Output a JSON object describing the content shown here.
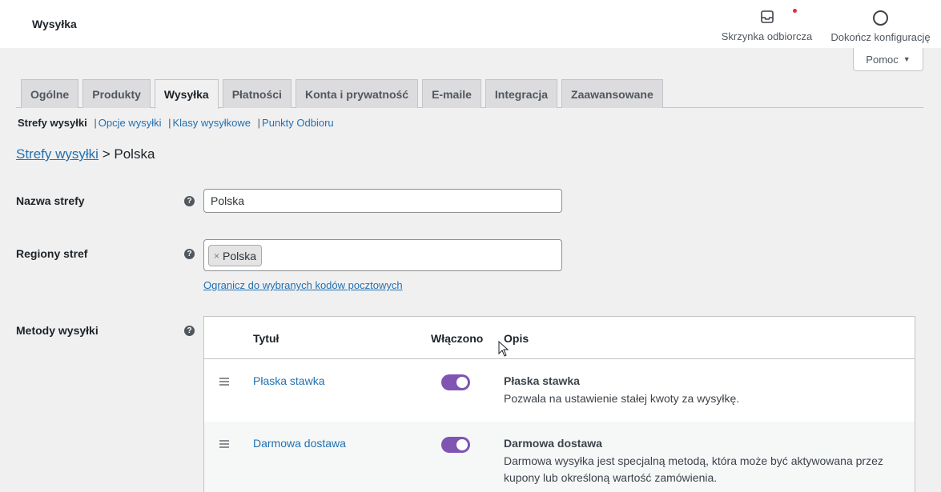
{
  "topbar": {
    "title": "Wysyłka",
    "inbox_label": "Skrzynka odbiorcza",
    "inbox_icon": "inbox-icon",
    "setup_label": "Dokończ konfigurację",
    "setup_icon": "progress-ring-icon"
  },
  "help": {
    "label": "Pomoc"
  },
  "tabs": [
    {
      "label": "Ogólne",
      "active": false
    },
    {
      "label": "Produkty",
      "active": false
    },
    {
      "label": "Wysyłka",
      "active": true
    },
    {
      "label": "Płatności",
      "active": false
    },
    {
      "label": "Konta i prywatność",
      "active": false
    },
    {
      "label": "E-maile",
      "active": false
    },
    {
      "label": "Integracja",
      "active": false
    },
    {
      "label": "Zaawansowane",
      "active": false
    }
  ],
  "subnav": {
    "current": "Strefy wysyłki",
    "links": [
      "Opcje wysyłki",
      "Klasy wysyłkowe",
      "Punkty Odbioru"
    ],
    "separator": "|"
  },
  "breadcrumb": {
    "parent": "Strefy wysyłki",
    "separator": ">",
    "current": "Polska"
  },
  "form": {
    "zone_name_label": "Nazwa strefy",
    "zone_name_value": "Polska",
    "regions_label": "Regiony stref",
    "regions": [
      {
        "label": "Polska",
        "remove": "×"
      }
    ],
    "zip_link": "Ogranicz do wybranych kodów pocztowych",
    "methods_label": "Metody wysyłki",
    "help_glyph": "?"
  },
  "methods": {
    "headers": {
      "title": "Tytuł",
      "enabled": "Włączono",
      "description": "Opis"
    },
    "rows": [
      {
        "title": "Płaska stawka",
        "enabled": true,
        "desc_title": "Płaska stawka",
        "desc": "Pozwala na ustawienie stałej kwoty za wysyłkę."
      },
      {
        "title": "Darmowa dostawa",
        "enabled": true,
        "desc_title": "Darmowa dostawa",
        "desc": "Darmowa wysyłka jest specjalną metodą, która może być aktywowana przez kupony lub określoną wartość zamówienia."
      }
    ]
  },
  "colors": {
    "link": "#2271b1",
    "toggle_on": "#7f54b3",
    "notice_dot": "#d63638"
  }
}
